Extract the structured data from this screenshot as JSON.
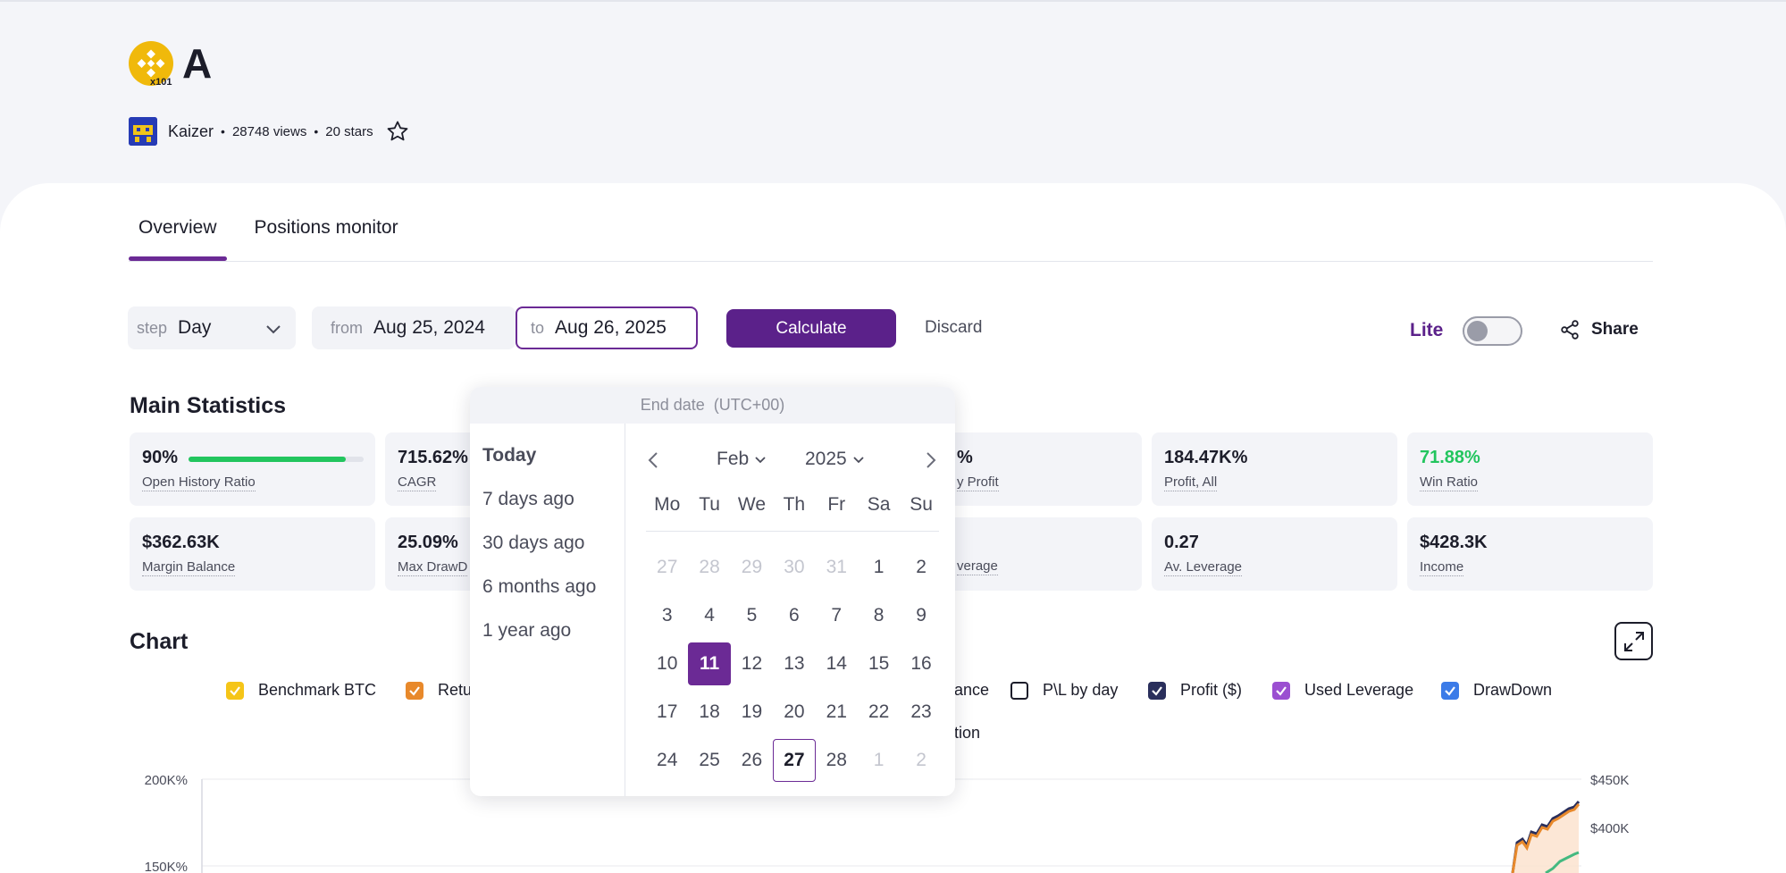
{
  "header": {
    "title": "A",
    "coin_icon": "binance-coin-icon",
    "coin_badge": "x101",
    "author": "Kaizer",
    "views": "28748 views",
    "stars": "20 stars",
    "separator": "•"
  },
  "tabs": [
    {
      "label": "Overview",
      "active": true
    },
    {
      "label": "Positions monitor",
      "active": false
    }
  ],
  "controls": {
    "step_label": "step",
    "step_value": "Day",
    "from_label": "from",
    "from_value": "Aug 25, 2024",
    "to_label": "to",
    "to_value": "Aug 26, 2025",
    "calculate_label": "Calculate",
    "discard_label": "Discard",
    "lite_label": "Lite",
    "lite_on": false,
    "share_label": "Share"
  },
  "statistics": {
    "title": "Main Statistics",
    "open_history_ratio": {
      "value": "90%",
      "label": "Open History Ratio",
      "fill": 0.9
    },
    "cagr": {
      "value": "715.62%",
      "label": "CAGR"
    },
    "daily_profit": {
      "value": "%",
      "label": "y Profit"
    },
    "profit_all": {
      "value": "184.47K%",
      "label": "Profit, All"
    },
    "win_ratio": {
      "value": "71.88%",
      "label": "Win Ratio"
    },
    "margin_balance": {
      "value": "$362.63K",
      "label": "Margin Balance"
    },
    "max_drawdown": {
      "value": "25.09%",
      "label": "Max DrawD"
    },
    "leverage_partial": {
      "label": "verage"
    },
    "av_leverage": {
      "value": "0.27",
      "label": "Av. Leverage"
    },
    "income": {
      "value": "$428.3K",
      "label": "Income"
    }
  },
  "chart_section": {
    "title": "Chart",
    "legend": [
      {
        "label": "Benchmark BTC",
        "checked": true,
        "color": "#f5c518"
      },
      {
        "label": "Retu",
        "checked": true,
        "color": "#e8892b"
      },
      {
        "label": "ance",
        "checked": false,
        "color": ""
      },
      {
        "label": "P\\L by day",
        "checked": false,
        "color": "#1c1d2a"
      },
      {
        "label": "Profit ($)",
        "checked": true,
        "color": "#2a2f5c"
      },
      {
        "label": "Used Leverage",
        "checked": true,
        "color": "#9b4fd1"
      },
      {
        "label": "DrawDown",
        "checked": true,
        "color": "#3b7be8"
      }
    ],
    "legend_second_row_partial": "tion"
  },
  "chart_data": {
    "type": "line",
    "y_left_ticks": [
      "200K%",
      "150K%"
    ],
    "y_right_ticks": [
      "$450K",
      "$400K"
    ],
    "series": []
  },
  "date_picker": {
    "header": "End date",
    "timezone": "(UTC+00)",
    "quick_options": [
      "Today",
      "7 days ago",
      "30 days ago",
      "6 months ago",
      "1 year ago"
    ],
    "month": "Feb",
    "year": "2025",
    "weekdays": [
      "Mo",
      "Tu",
      "We",
      "Th",
      "Fr",
      "Sa",
      "Su"
    ],
    "weeks": [
      [
        {
          "d": "27",
          "m": true
        },
        {
          "d": "28",
          "m": true
        },
        {
          "d": "29",
          "m": true
        },
        {
          "d": "30",
          "m": true
        },
        {
          "d": "31",
          "m": true
        },
        {
          "d": "1"
        },
        {
          "d": "2"
        }
      ],
      [
        {
          "d": "3"
        },
        {
          "d": "4"
        },
        {
          "d": "5"
        },
        {
          "d": "6"
        },
        {
          "d": "7"
        },
        {
          "d": "8"
        },
        {
          "d": "9"
        }
      ],
      [
        {
          "d": "10"
        },
        {
          "d": "11",
          "sel": true
        },
        {
          "d": "12"
        },
        {
          "d": "13"
        },
        {
          "d": "14"
        },
        {
          "d": "15"
        },
        {
          "d": "16"
        }
      ],
      [
        {
          "d": "17"
        },
        {
          "d": "18"
        },
        {
          "d": "19"
        },
        {
          "d": "20"
        },
        {
          "d": "21"
        },
        {
          "d": "22"
        },
        {
          "d": "23"
        }
      ],
      [
        {
          "d": "24"
        },
        {
          "d": "25"
        },
        {
          "d": "26"
        },
        {
          "d": "27",
          "today": true
        },
        {
          "d": "28"
        },
        {
          "d": "1",
          "m": true
        },
        {
          "d": "2",
          "m": true
        }
      ]
    ]
  },
  "colors": {
    "accent": "#6b2a95",
    "button": "#5b218a",
    "positive": "#22c55e",
    "coin": "#f0b90b"
  }
}
